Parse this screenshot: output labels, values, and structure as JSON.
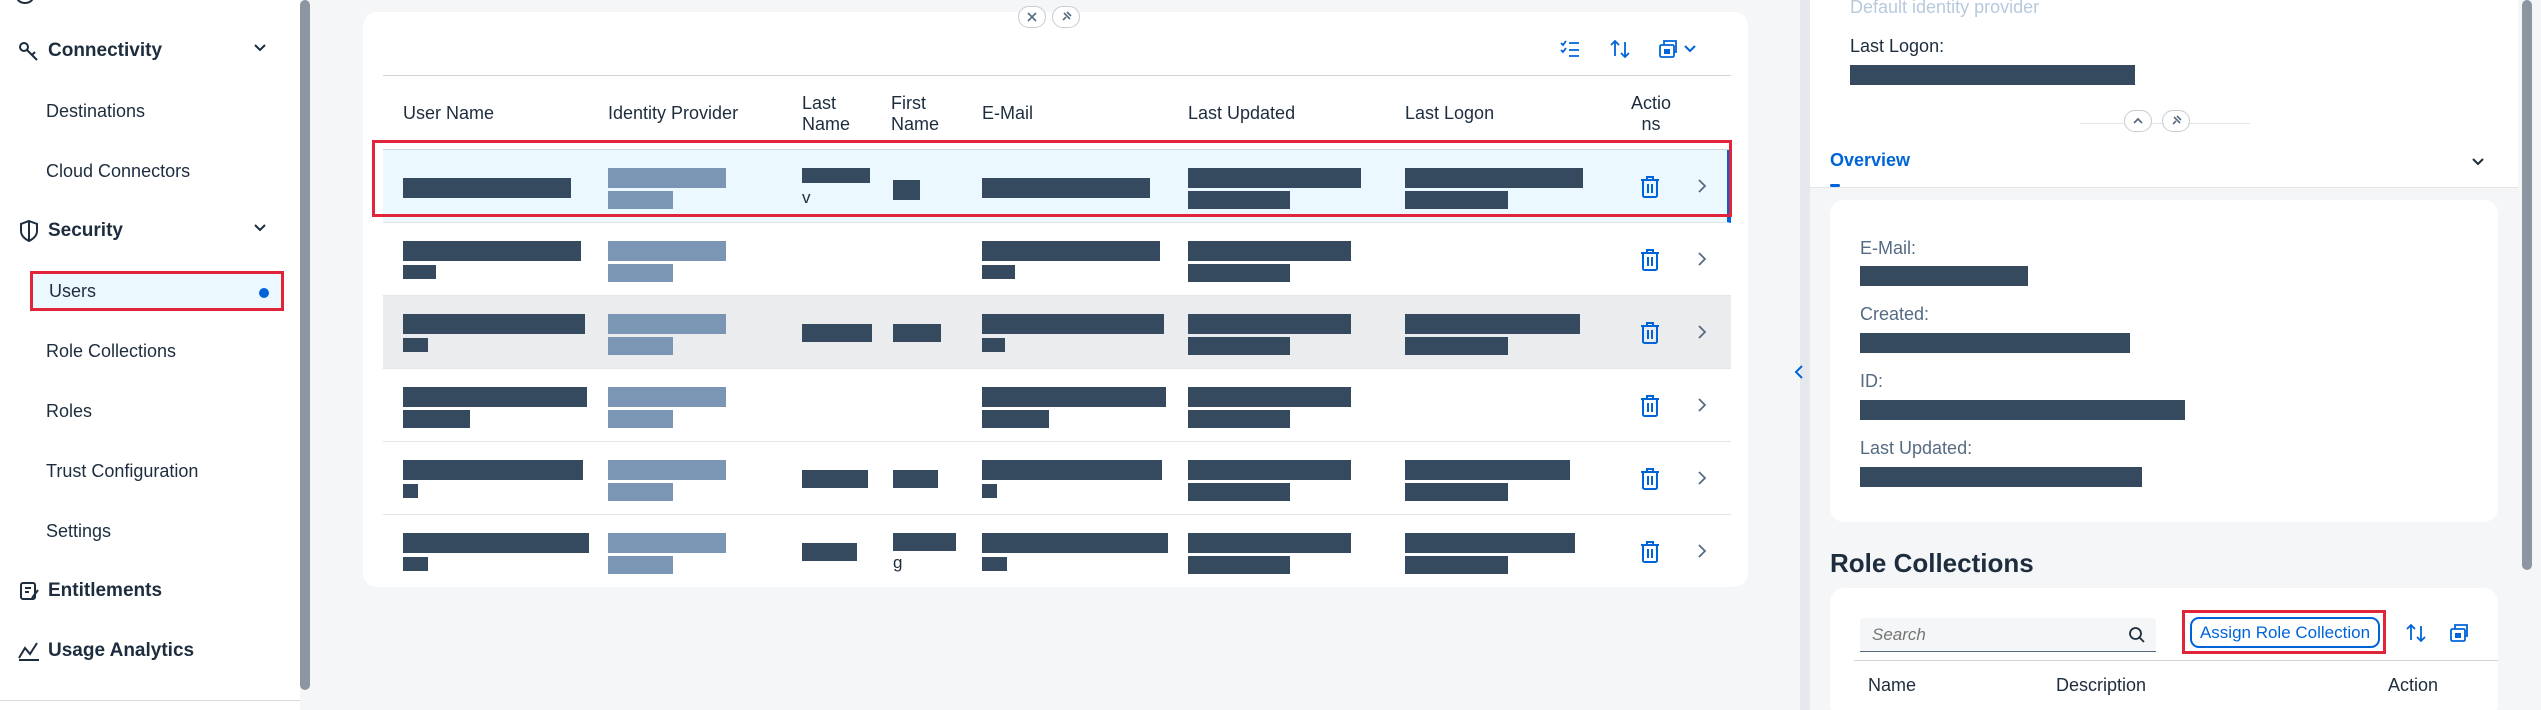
{
  "sidebar": {
    "groups": [
      {
        "label": "Connectivity"
      },
      {
        "label": "Security"
      },
      {
        "label": "Entitlements"
      },
      {
        "label": "Usage Analytics"
      }
    ],
    "items": [
      {
        "label": "Destinations"
      },
      {
        "label": "Cloud Connectors"
      },
      {
        "label": "Users"
      },
      {
        "label": "Role Collections"
      },
      {
        "label": "Roles"
      },
      {
        "label": "Trust Configuration"
      },
      {
        "label": "Settings"
      }
    ],
    "selected_item": "Users"
  },
  "table": {
    "columns": {
      "user_name": "User Name",
      "identity_provider": "Identity Provider",
      "last_name_1": "Last",
      "last_name_2": "Name",
      "first_name_1": "First",
      "first_name_2": "Name",
      "email": "E-Mail",
      "last_updated": "Last Updated",
      "last_logon": "Last Logon",
      "actions_1": "Actio",
      "actions_2": "ns"
    },
    "row_fragments": {
      "row1_last_name": "v",
      "row6_first_name": "g"
    },
    "row_count": 6
  },
  "detail": {
    "identity_provider_hint": "Default identity provider",
    "last_logon_label": "Last Logon:",
    "tab_overview": "Overview",
    "fields": {
      "email": "E-Mail:",
      "created": "Created:",
      "id": "ID:",
      "last_updated": "Last Updated:"
    },
    "role_collections": {
      "title": "Role Collections",
      "search_placeholder": "Search",
      "assign_button": "Assign Role Collection",
      "columns": {
        "name": "Name",
        "description": "Description",
        "action": "Action"
      }
    }
  },
  "colors": {
    "accent": "#0064d9",
    "highlight_outline": "#e0253b",
    "redacted": "#354a5f",
    "redacted_link": "#7b96b4"
  }
}
